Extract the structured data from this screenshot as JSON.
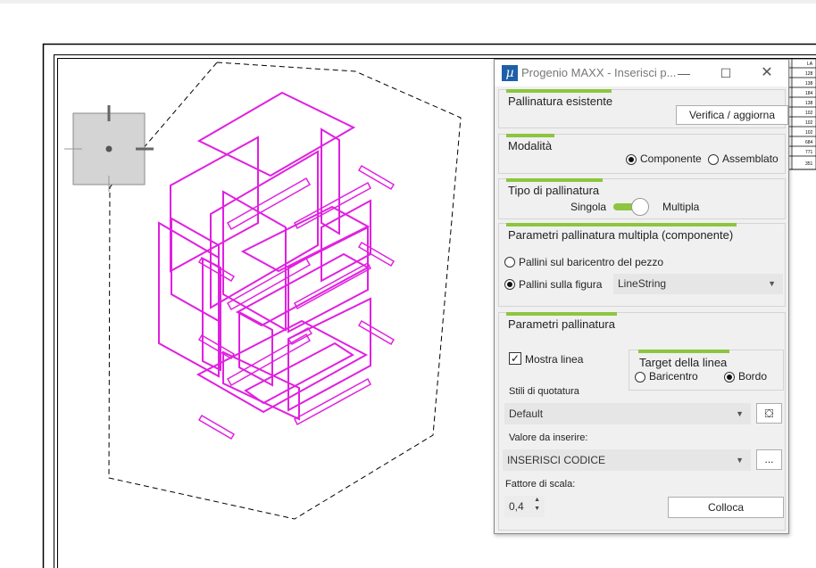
{
  "dialog": {
    "title": "Progenio MAXX - Inserisci p...",
    "app_icon": "µ",
    "controls": {
      "minimize": "—",
      "maximize": "☐",
      "close": "✕"
    },
    "existing": {
      "title": "Pallinatura esistente",
      "verify_button": "Verifica / aggiorna"
    },
    "mode": {
      "title": "Modalità",
      "options": [
        "Componente",
        "Assemblato"
      ],
      "selected": "Componente"
    },
    "type": {
      "title": "Tipo di pallinatura",
      "left": "Singola",
      "right": "Multipla",
      "value": "Multipla"
    },
    "multi": {
      "title": "Parametri pallinatura multipla (componente)",
      "option_center": "Pallini sul baricentro del pezzo",
      "option_figure": "Pallini sulla figura",
      "selected": "Pallini sulla figura",
      "figure_combo": "LineString"
    },
    "params": {
      "title": "Parametri pallinatura",
      "show_line_label": "Mostra linea",
      "show_line_checked": true,
      "target": {
        "title": "Target della linea",
        "options": [
          "Baricentro",
          "Bordo"
        ],
        "selected": "Bordo"
      },
      "styles_label": "Stili di quotatura",
      "style_value": "Default",
      "value_label": "Valore da inserire:",
      "value_value": "INSERISCI CODICE",
      "more_button": "...",
      "scale_label": "Fattore di scala:",
      "scale_value": "0,4",
      "place_button": "Colloca"
    }
  },
  "table_fragment": {
    "header": "LA",
    "rows": [
      "128",
      "138",
      "184",
      "138",
      "102",
      "102",
      "102",
      "684",
      "771",
      "351"
    ]
  },
  "colors": {
    "drawing": "#e020e0",
    "accent": "#8cc63f",
    "sheet_border": "#000000"
  }
}
